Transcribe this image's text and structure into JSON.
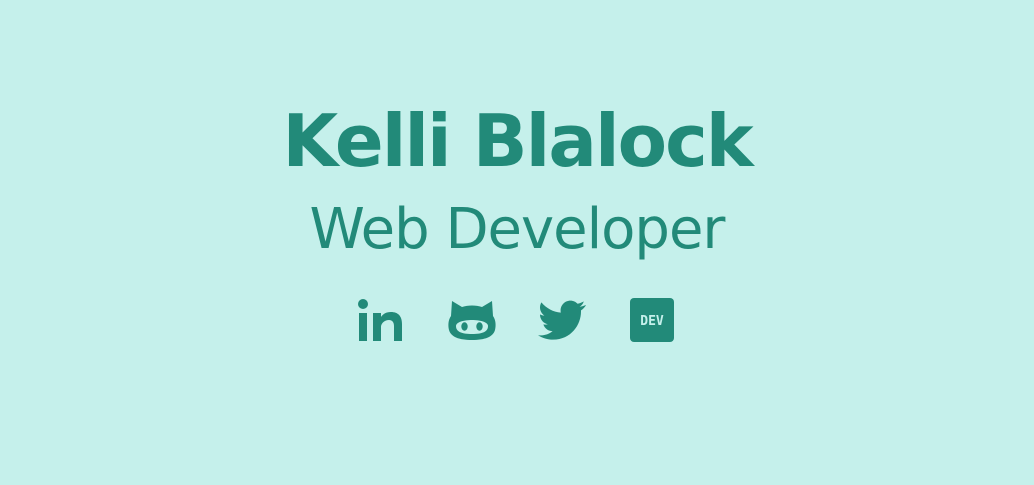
{
  "profile": {
    "name": "Kelli Blalock",
    "title": "Web Developer"
  },
  "social": {
    "links": [
      {
        "icon": "linkedin-icon",
        "label": "in"
      },
      {
        "icon": "github-icon"
      },
      {
        "icon": "twitter-icon"
      },
      {
        "icon": "dev-icon",
        "label": "DEV"
      }
    ]
  },
  "colors": {
    "background": "#c5f0eb",
    "accent": "#228a79"
  }
}
